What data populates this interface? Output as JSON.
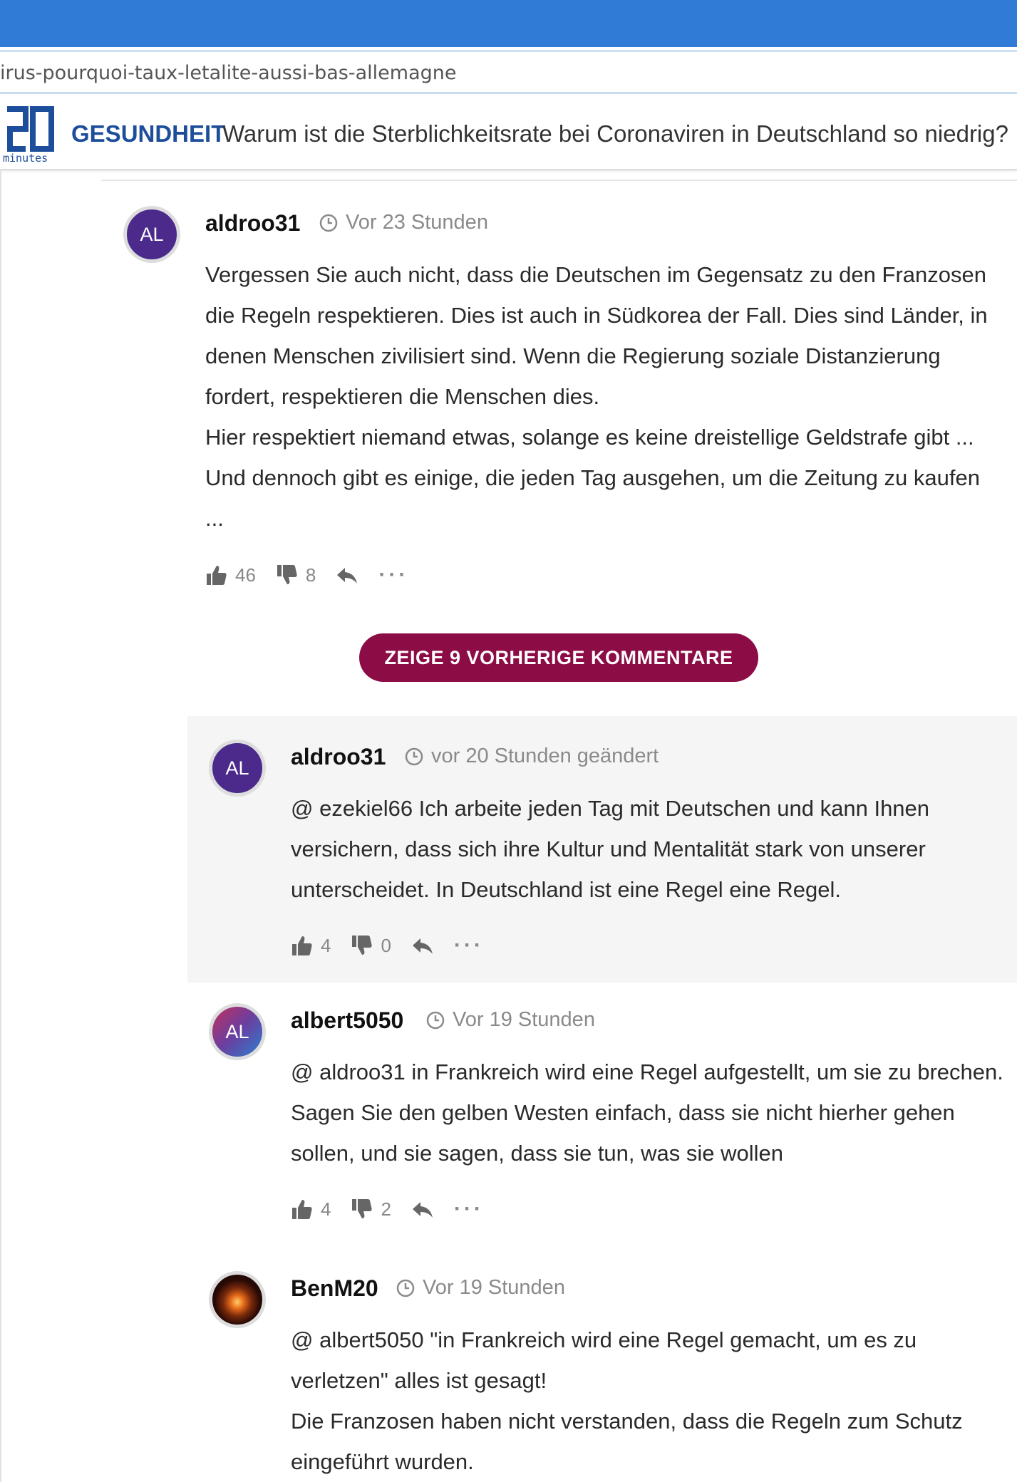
{
  "browser": {
    "url_fragment": "irus-pourquoi-taux-letalite-aussi-bas-allemagne"
  },
  "header": {
    "logo_caption": "minutes",
    "section": "GESUNDHEIT",
    "title": "Warum ist die Sterblichkeitsrate bei Coronaviren in Deutschland so niedrig?"
  },
  "comments": [
    {
      "avatar": "AL",
      "author": "aldroo31",
      "time": "Vor 23 Stunden",
      "body": [
        "Vergessen Sie auch nicht, dass die Deutschen im Gegensatz zu den Franzosen die Regeln respektieren. Dies ist auch in Südkorea der Fall. Dies sind Länder, in denen Menschen zivilisiert sind. Wenn die Regierung soziale Distanzierung fordert, respektieren die Menschen dies.",
        "Hier respektiert niemand etwas, solange es keine dreistellige Geldstrafe gibt ... Und dennoch gibt es einige, die jeden Tag ausgehen, um die Zeitung zu kaufen ..."
      ],
      "likes": "46",
      "dislikes": "8",
      "more": "···"
    },
    {
      "avatar": "AL",
      "author": "aldroo31",
      "time": "vor 20 Stunden geändert",
      "body": [
        "@ ezekiel66 Ich arbeite jeden Tag mit Deutschen und kann Ihnen versichern, dass sich ihre Kultur und Mentalität stark von unserer unterscheidet. In Deutschland ist eine Regel eine Regel."
      ],
      "likes": "4",
      "dislikes": "0",
      "more": "···"
    },
    {
      "avatar": "AL",
      "author": "albert5050",
      "time": "Vor 19 Stunden",
      "body": [
        "@ aldroo31 in Frankreich wird eine Regel aufgestellt, um sie zu brechen. Sagen Sie den gelben Westen einfach, dass sie nicht hierher gehen sollen, und sie sagen, dass sie tun, was sie wollen"
      ],
      "likes": "4",
      "dislikes": "2",
      "more": "···"
    },
    {
      "avatar": "",
      "author": "BenM20",
      "time": "Vor 19 Stunden",
      "body": [
        "@ albert5050 \"in Frankreich wird eine Regel gemacht, um es zu verletzen\" alles ist gesagt!",
        "Die Franzosen haben nicht verstanden, dass die Regeln zum Schutz eingeführt wurden."
      ]
    }
  ],
  "show_more_label": "ZEIGE 9 VORHERIGE KOMMENTARE",
  "colors": {
    "browser_bar": "#2f7bd6",
    "brand_blue": "#1d4e9b",
    "button": "#8c0c46",
    "reply_background": "#f5f5f5"
  }
}
